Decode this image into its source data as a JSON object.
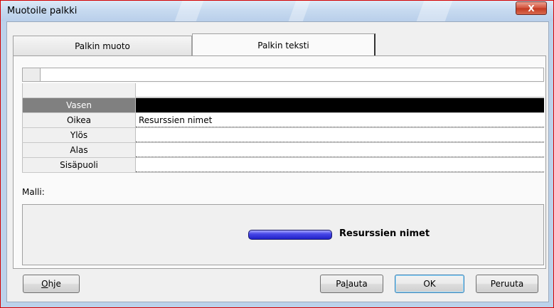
{
  "window": {
    "title": "Muotoile palkki",
    "close_label": "X"
  },
  "tabs": [
    {
      "label": "Palkin muoto"
    },
    {
      "label": "Palkin teksti"
    }
  ],
  "grid": {
    "rows": [
      {
        "label": "Vasen",
        "value": ""
      },
      {
        "label": "Oikea",
        "value": "Resurssien nimet"
      },
      {
        "label": "Ylös",
        "value": ""
      },
      {
        "label": "Alas",
        "value": ""
      },
      {
        "label": "Sisäpuoli",
        "value": ""
      }
    ],
    "selected_row": "Vasen"
  },
  "preview": {
    "label": "Malli:",
    "sample_text": "Resurssien nimet",
    "bar_color": "#3a3ae0"
  },
  "buttons": {
    "help": {
      "before": "",
      "mnemonic": "O",
      "after": "hje"
    },
    "reset": {
      "before": "Pa",
      "mnemonic": "l",
      "after": "auta"
    },
    "ok": "OK",
    "cancel": "Peruuta"
  }
}
